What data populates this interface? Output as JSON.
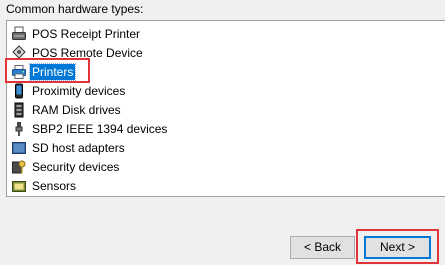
{
  "section_label": "Common hardware types:",
  "hardware_types": {
    "items": [
      {
        "label": "POS Receipt Printer",
        "icon": "receipt-printer-icon"
      },
      {
        "label": "POS Remote Device",
        "icon": "remote-device-icon"
      },
      {
        "label": "Printers",
        "icon": "printer-icon",
        "selected": true
      },
      {
        "label": "Proximity devices",
        "icon": "proximity-device-icon"
      },
      {
        "label": "RAM Disk drives",
        "icon": "ram-disk-icon"
      },
      {
        "label": "SBP2 IEEE 1394 devices",
        "icon": "ieee1394-icon"
      },
      {
        "label": "SD host adapters",
        "icon": "sd-adapter-icon"
      },
      {
        "label": "Security devices",
        "icon": "security-device-icon"
      },
      {
        "label": "Sensors",
        "icon": "sensor-icon"
      }
    ]
  },
  "buttons": {
    "back": "< Back",
    "next": "Next >"
  },
  "colors": {
    "selection": "#0078d7",
    "annotation_highlight": "#e0343a"
  }
}
